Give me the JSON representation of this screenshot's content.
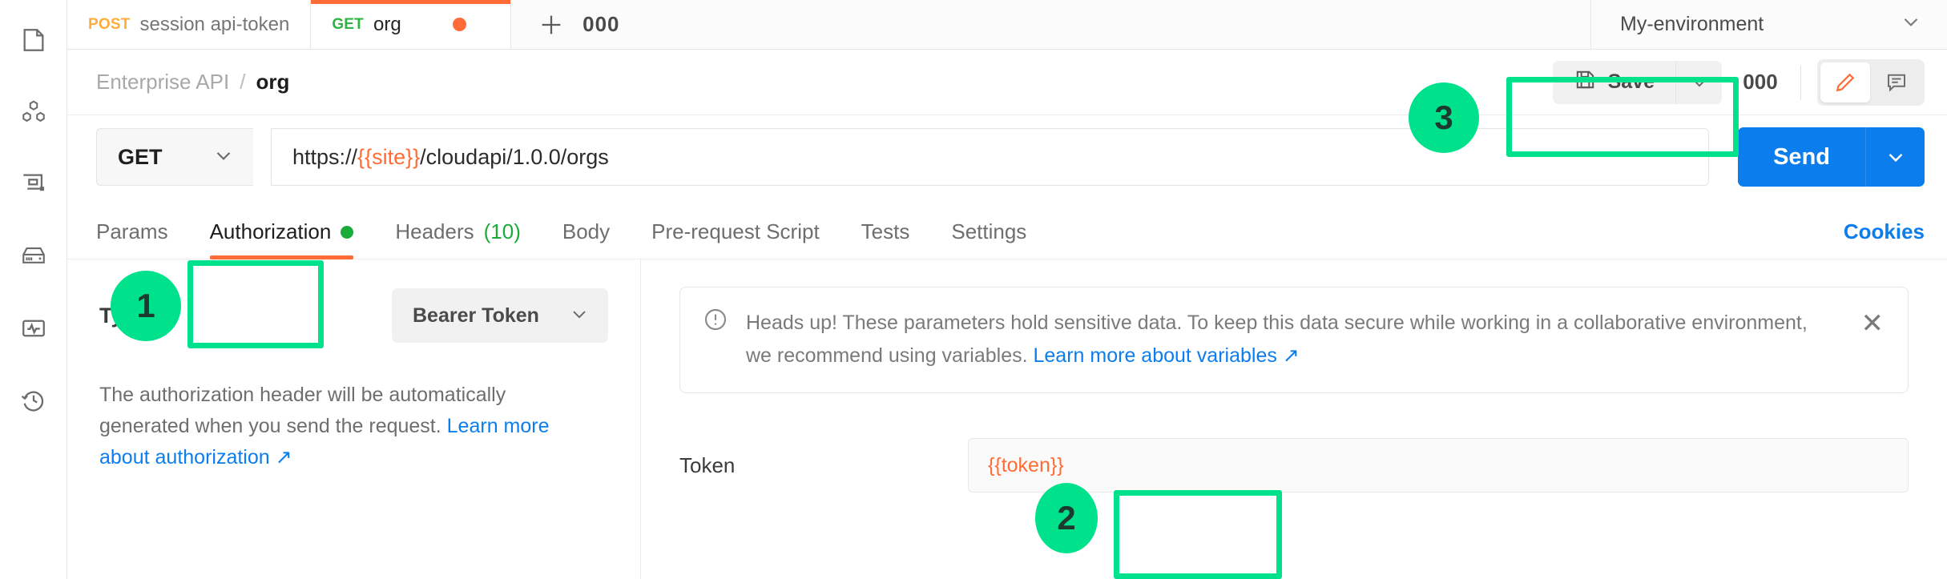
{
  "sidebar": {
    "items": [
      {
        "name": "collections-icon",
        "label": "Collections"
      },
      {
        "name": "apis-icon",
        "label": "APIs"
      },
      {
        "name": "environments-icon",
        "label": "Environments"
      },
      {
        "name": "mock-servers-icon",
        "label": "Mock Servers"
      },
      {
        "name": "monitors-icon",
        "label": "Monitors"
      },
      {
        "name": "history-icon",
        "label": "History"
      }
    ]
  },
  "tabstrip": {
    "tabs": [
      {
        "method": "POST",
        "name": "session api-token",
        "active": false,
        "unsaved": false
      },
      {
        "method": "GET",
        "name": "org",
        "active": true,
        "unsaved": true
      }
    ],
    "new_tab_icon": "plus-icon",
    "more_tabs_label": "000",
    "environment": {
      "selected": "My-environment",
      "caret_icon": "chevron-down-icon"
    }
  },
  "breadcrumb": {
    "parent": "Enterprise API",
    "separator": "/",
    "current": "org"
  },
  "toolbar": {
    "save_label": "Save",
    "save_icon": "floppy-disk-icon",
    "save_caret_icon": "chevron-down-icon",
    "more_label": "000",
    "edit_icon": "pencil-icon",
    "comment_icon": "comment-icon"
  },
  "request": {
    "method": "GET",
    "method_caret_icon": "chevron-down-icon",
    "url_prefix": "https://",
    "url_variable": "{{site}}",
    "url_suffix": "/cloudapi/1.0.0/orgs",
    "send_label": "Send",
    "send_caret_icon": "chevron-down-icon"
  },
  "section_tabs": {
    "tabs": [
      {
        "label": "Params",
        "active": false,
        "dot": false,
        "count": ""
      },
      {
        "label": "Authorization",
        "active": true,
        "dot": true,
        "count": ""
      },
      {
        "label": "Headers",
        "active": false,
        "dot": false,
        "count": "(10)"
      },
      {
        "label": "Body",
        "active": false,
        "dot": false,
        "count": ""
      },
      {
        "label": "Pre-request Script",
        "active": false,
        "dot": false,
        "count": ""
      },
      {
        "label": "Tests",
        "active": false,
        "dot": false,
        "count": ""
      },
      {
        "label": "Settings",
        "active": false,
        "dot": false,
        "count": ""
      }
    ],
    "cookies_label": "Cookies"
  },
  "auth_panel": {
    "type_label": "Type",
    "type_value": "Bearer Token",
    "type_caret_icon": "chevron-down-icon",
    "description_text": "The authorization header will be automatically generated when you send the request. ",
    "description_link": "Learn more about authorization ↗"
  },
  "notice": {
    "icon": "exclamation-circle-icon",
    "text": "Heads up! These parameters hold sensitive data. To keep this data secure while working in a collaborative environment, we recommend using variables. ",
    "link": "Learn more about variables ↗",
    "close_icon": "close-icon"
  },
  "token_field": {
    "label": "Token",
    "value": "{{token}}",
    "placeholder": "Token"
  },
  "annotations": [
    {
      "number": "1",
      "target": "authorization-tab"
    },
    {
      "number": "2",
      "target": "token-input"
    },
    {
      "number": "3",
      "target": "save-button"
    }
  ],
  "colors": {
    "accent_orange": "#ff6c37",
    "send_blue": "#0c7ded",
    "link_blue": "#0c7ded",
    "get_green": "#2fb344",
    "post_yellow": "#ffac3b",
    "annotation_green": "#00e18c"
  }
}
